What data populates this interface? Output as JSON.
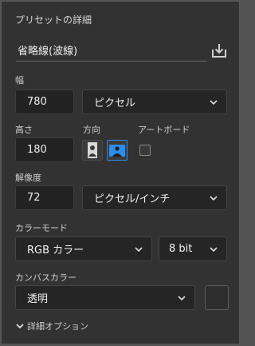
{
  "panel": {
    "title": "プリセットの詳細",
    "preset_name": "省略線(波線)",
    "width": {
      "label": "幅",
      "value": "780",
      "unit": "ピクセル"
    },
    "height": {
      "label": "高さ",
      "value": "180"
    },
    "orientation": {
      "label": "方向",
      "selected": "landscape"
    },
    "artboard": {
      "label": "アートボード",
      "checked": false
    },
    "resolution": {
      "label": "解像度",
      "value": "72",
      "unit": "ピクセル/インチ"
    },
    "color_mode": {
      "label": "カラーモード",
      "mode": "RGB カラー",
      "bits": "8 bit"
    },
    "canvas_color": {
      "label": "カンバスカラー",
      "value": "透明"
    },
    "advanced": {
      "label": "詳細オプション"
    }
  },
  "colors": {
    "accent": "#2d8ceb",
    "panel_bg": "#323232",
    "field_bg": "#222222"
  },
  "icons": {
    "save_preset": "save-preset-icon",
    "portrait": "portrait-icon",
    "landscape": "landscape-icon",
    "dropdown": "chevron-down-icon"
  }
}
